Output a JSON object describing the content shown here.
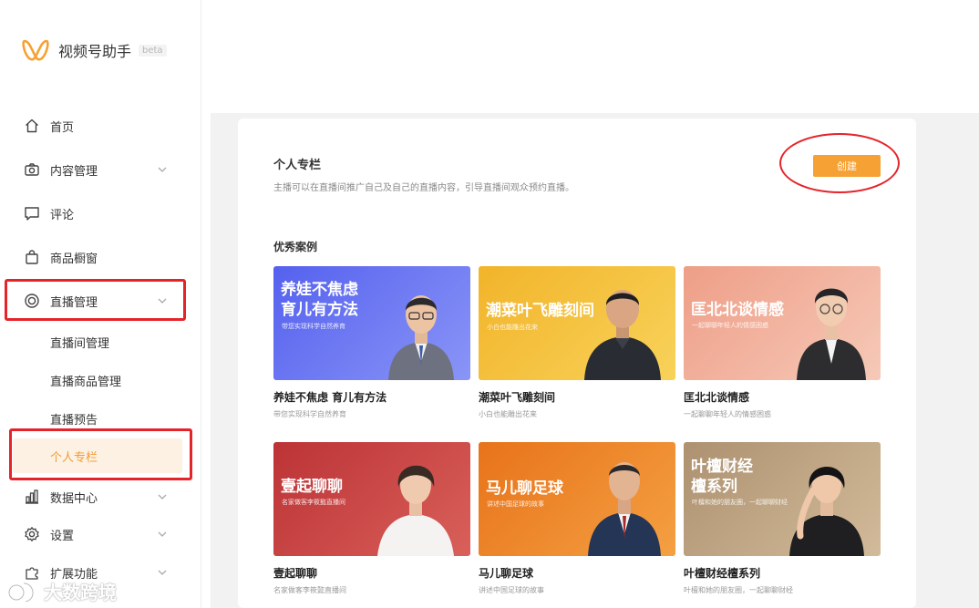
{
  "app": {
    "name": "视频号助手",
    "badge": "beta"
  },
  "sidebar": {
    "items": [
      {
        "label": "首页",
        "icon": "home-icon"
      },
      {
        "label": "内容管理",
        "icon": "camera-icon"
      },
      {
        "label": "评论",
        "icon": "comment-icon"
      },
      {
        "label": "商品橱窗",
        "icon": "bag-icon"
      },
      {
        "label": "直播管理",
        "icon": "live-icon"
      },
      {
        "label": "数据中心",
        "icon": "chart-icon"
      },
      {
        "label": "设置",
        "icon": "gear-icon"
      },
      {
        "label": "扩展功能",
        "icon": "puzzle-icon"
      }
    ],
    "live_sub": [
      {
        "label": "直播间管理"
      },
      {
        "label": "直播商品管理"
      },
      {
        "label": "直播预告"
      },
      {
        "label": "个人专栏"
      }
    ]
  },
  "main": {
    "title": "个人专栏",
    "description": "主播可以在直播间推广自己及自己的直播内容，引导直播间观众预约直播。",
    "create_label": "创建",
    "cases_title": "优秀案例",
    "cases": [
      {
        "banner_title": "养娃不焦虑\n育儿有方法",
        "banner_sub": "带您实现科学自然养育",
        "title": "养娃不焦虑 育儿有方法",
        "sub": "带您实现科学自然养育",
        "color1": "#5b6af0",
        "color2": "#8390f5"
      },
      {
        "banner_title": "潮菜叶飞雕刻间",
        "banner_sub": "小白也能雕出花来",
        "title": "潮菜叶飞雕刻间",
        "sub": "小白也能雕出花来",
        "color1": "#f3b92e",
        "color2": "#f7cf52"
      },
      {
        "banner_title": "匡北北谈情感",
        "banner_sub": "一起聊聊年轻人的情感困惑",
        "title": "匡北北谈情感",
        "sub": "一起聊聊年轻人的情感困惑",
        "color1": "#f0a78f",
        "color2": "#f7c6b3"
      },
      {
        "banner_title": "壹起聊聊",
        "banner_sub": "名家做客李筱懿直播间",
        "title": "壹起聊聊",
        "sub": "名家做客李筱懿直播间",
        "color1": "#c23a3c",
        "color2": "#d65a55"
      },
      {
        "banner_title": "马儿聊足球",
        "banner_sub": "讲述中国足球的故事",
        "title": "马儿聊足球",
        "sub": "讲述中国足球的故事",
        "color1": "#ea7a1a",
        "color2": "#f39a38"
      },
      {
        "banner_title": "叶檀财经\n檀系列",
        "banner_sub": "叶檀和她的朋友圈，一起聊聊财经",
        "title": "叶檀财经檀系列",
        "sub": "叶檀和她的朋友圈，一起聊聊财经",
        "color1": "#b59a78",
        "color2": "#cdb594"
      }
    ]
  },
  "watermark": {
    "text": "大数跨境"
  },
  "colors": {
    "accent": "#f6a133",
    "highlight": "#e5242a",
    "active_bg": "#fdf1e4"
  }
}
